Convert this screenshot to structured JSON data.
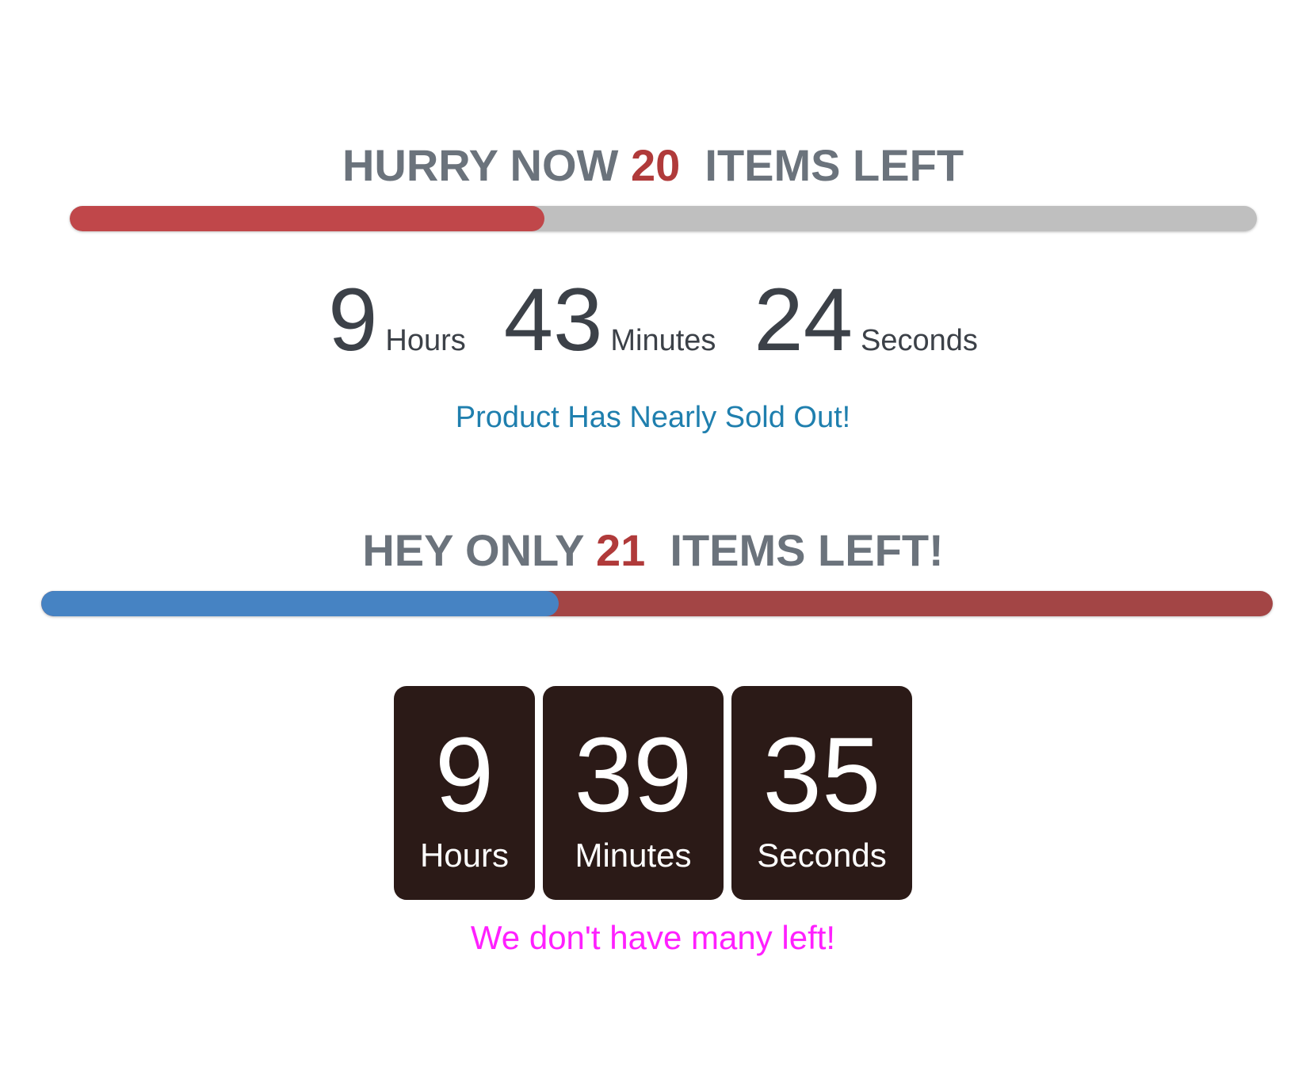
{
  "widget1": {
    "headline_prefix": "HURRY NOW ",
    "count": "20",
    "headline_suffix": "  ITEMS LEFT",
    "progress_fraction": 0.4,
    "colors": {
      "fill": "#c0474a",
      "track": "#bfbfbf",
      "count": "#b03a3a",
      "message": "#1f7fae"
    },
    "timer": {
      "hours": "9",
      "hours_label": "Hours",
      "minutes": "43",
      "minutes_label": "Minutes",
      "seconds": "24",
      "seconds_label": "Seconds"
    },
    "message": "Product Has Nearly Sold Out!"
  },
  "widget2": {
    "headline_prefix": "HEY ONLY ",
    "count": "21",
    "headline_suffix": "  ITEMS LEFT!",
    "progress_fraction": 0.42,
    "colors": {
      "fill": "#4683c3",
      "track": "#a34545",
      "count": "#b03a3a",
      "box": "#2b1a17",
      "message": "#ff20ff"
    },
    "timer": {
      "hours": "9",
      "hours_label": "Hours",
      "minutes": "39",
      "minutes_label": "Minutes",
      "seconds": "35",
      "seconds_label": "Seconds"
    },
    "message": "We don't have many left!"
  }
}
